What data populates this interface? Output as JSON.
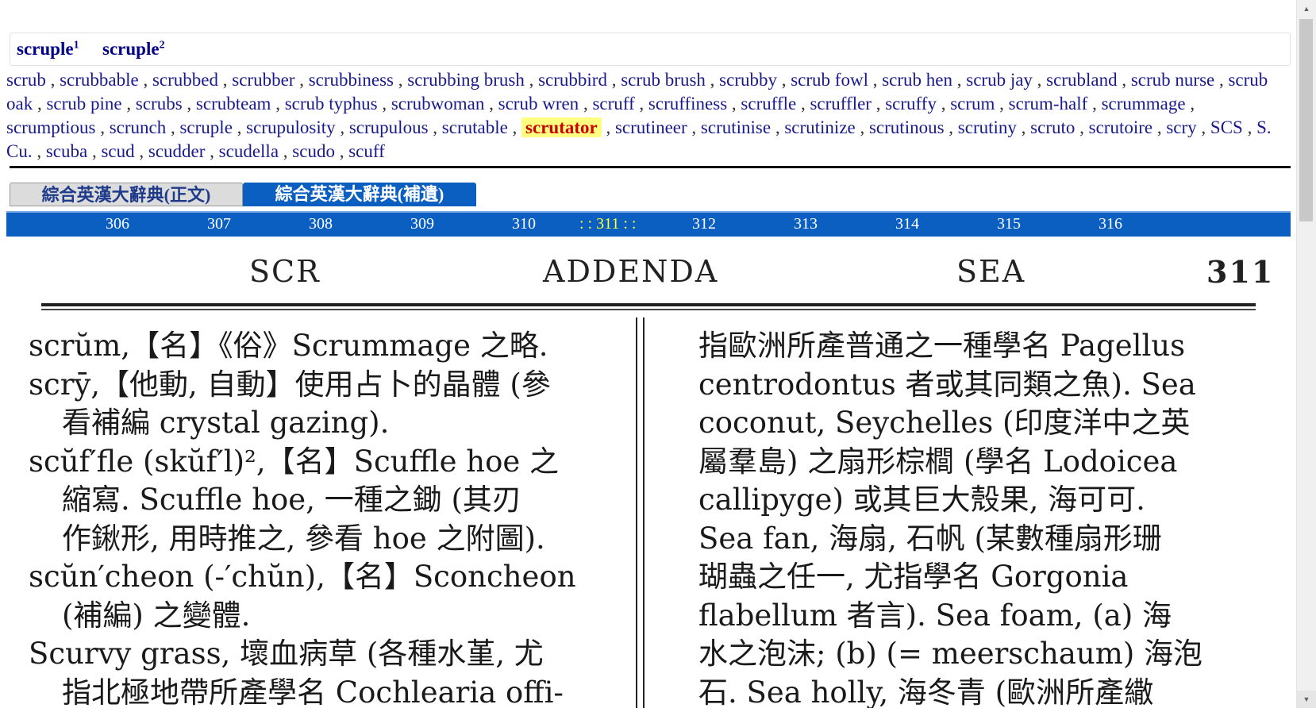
{
  "headwords": [
    {
      "text": "scruple",
      "sup": "1"
    },
    {
      "text": "scruple",
      "sup": "2"
    }
  ],
  "wordlist": {
    "current_index": 35,
    "items": [
      "scrub",
      "scrubbable",
      "scrubbed",
      "scrubber",
      "scrubbiness",
      "scrubbing brush",
      "scrubbird",
      "scrub brush",
      "scrubby",
      "scrub fowl",
      "scrub hen",
      "scrub jay",
      "scrubland",
      "scrub nurse",
      "scrub oak",
      "scrub pine",
      "scrubs",
      "scrubteam",
      "scrub typhus",
      "scrubwoman",
      "scrub wren",
      "scruff",
      "scruffiness",
      "scruffle",
      "scruffler",
      "scruffy",
      "scrum",
      "scrum-half",
      "scrummage",
      "scrumptious",
      "scrunch",
      "scruple",
      "scrupulosity",
      "scrupulous",
      "scrutable",
      "scrutator",
      "scrutineer",
      "scrutinise",
      "scrutinize",
      "scrutinous",
      "scrutiny",
      "scruto",
      "scrutoire",
      "scry",
      "SCS",
      "S. Cu.",
      "scuba",
      "scud",
      "scudder",
      "scudella",
      "scudo",
      "scuff"
    ]
  },
  "tabs": [
    {
      "label": "綜合英漢大辭典(正文)",
      "active": false
    },
    {
      "label": "綜合英漢大辭典(補遺)",
      "active": true
    }
  ],
  "pages": {
    "items": [
      "306",
      "307",
      "308",
      "309",
      "310",
      ": : 311 : :",
      "312",
      "313",
      "314",
      "315",
      "316"
    ],
    "current": "311"
  },
  "scan": {
    "running_head": {
      "left": "SCR",
      "center": "ADDENDA",
      "right": "SEA",
      "page": "311"
    },
    "left_column": [
      "scrŭm,【名】《俗》Scrummage 之略.",
      "scrȳ,【他動, 自動】使用占卜的晶體 (參",
      "看補編 crystal gazing).",
      "scŭf′fle (skŭf′l)²,【名】Scuffle hoe 之",
      "縮寫. Scuffle hoe, 一種之鋤 (其刃",
      "作鍬形, 用時推之, 參看 hoe 之附圖).",
      "scŭn′cheon (-′chŭn),【名】Sconcheon",
      "(補編) 之變體.",
      "Scurvy grass, 壞血病草 (各種水堇, 尤",
      "指北極地帶所產學名 Cochlearia offi-"
    ],
    "right_column": [
      "指歐洲所產普通之一種學名 Pagellus",
      "centrodontus 者或其同類之魚). Sea",
      "coconut, Seychelles (印度洋中之英",
      "屬羣島) 之扇形棕櫚 (學名 Lodoicea",
      "callipyge) 或其巨大殼果, 海可可.",
      "Sea fan, 海扇, 石帆 (某數種扇形珊",
      "瑚蟲之任一, 尤指學名 Gorgonia",
      "flabellum 者言). Sea foam, (a) 海",
      "水之泡沫; (b) (= meerschaum) 海泡",
      "石. Sea holly, 海冬青 (歐洲所產繖"
    ]
  },
  "scrollbar": {
    "up_arrow": "▲",
    "down_arrow": "▼"
  },
  "colors": {
    "accent_blue": "#0b5fc1",
    "link_blue": "#1a1a8c",
    "highlight": "#ffff80",
    "current_page": "#ffff33"
  }
}
